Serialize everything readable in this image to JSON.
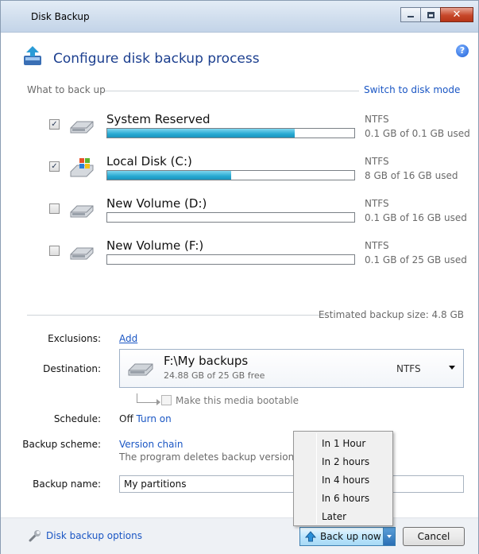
{
  "window": {
    "title": "Disk Backup"
  },
  "header": {
    "title": "Configure disk backup process",
    "help_icon": "help-icon"
  },
  "what_to_back_up": {
    "label": "What to back up",
    "switch_link": "Switch to disk mode"
  },
  "volumes": [
    {
      "name": "System Reserved",
      "checked": true,
      "fs": "NTFS",
      "usage": "0.1 GB of 0.1 GB used",
      "used_fraction": 0.76,
      "icon": "drive-icon"
    },
    {
      "name": "Local Disk (C:)",
      "checked": true,
      "fs": "NTFS",
      "usage": "8 GB of 16 GB used",
      "used_fraction": 0.5,
      "icon": "windows-drive-icon"
    },
    {
      "name": "New Volume (D:)",
      "checked": false,
      "fs": "NTFS",
      "usage": "0.1 GB of 16 GB used",
      "used_fraction": 0.0,
      "icon": "drive-icon"
    },
    {
      "name": "New Volume (F:)",
      "checked": false,
      "fs": "NTFS",
      "usage": "0.1 GB of 25 GB used",
      "used_fraction": 0.0,
      "icon": "drive-icon"
    }
  ],
  "estimate": "Estimated backup size: 4.8 GB",
  "exclusions": {
    "label": "Exclusions:",
    "link": "Add"
  },
  "destination": {
    "label": "Destination:",
    "path": "F:\\My backups",
    "free": "24.88 GB of 25 GB free",
    "fs": "NTFS",
    "bootable_label": "Make this media bootable"
  },
  "schedule": {
    "label": "Schedule:",
    "state": "Off",
    "link": "Turn on"
  },
  "scheme": {
    "label": "Backup scheme:",
    "link": "Version chain",
    "description": "The program deletes backup versions o"
  },
  "backup_name": {
    "label": "Backup name:",
    "value": "My partitions"
  },
  "footer": {
    "options_link": "Disk backup options",
    "backup_button": "Back up now",
    "cancel_button": "Cancel"
  },
  "backup_menu": [
    "In 1 Hour",
    "In 2 hours",
    "In 4 hours",
    "In 6 hours",
    "Later"
  ],
  "colors": {
    "accent_link": "#1a56c4",
    "bar_fill": "#27a9d2",
    "title_text": "#1c3f8f"
  }
}
